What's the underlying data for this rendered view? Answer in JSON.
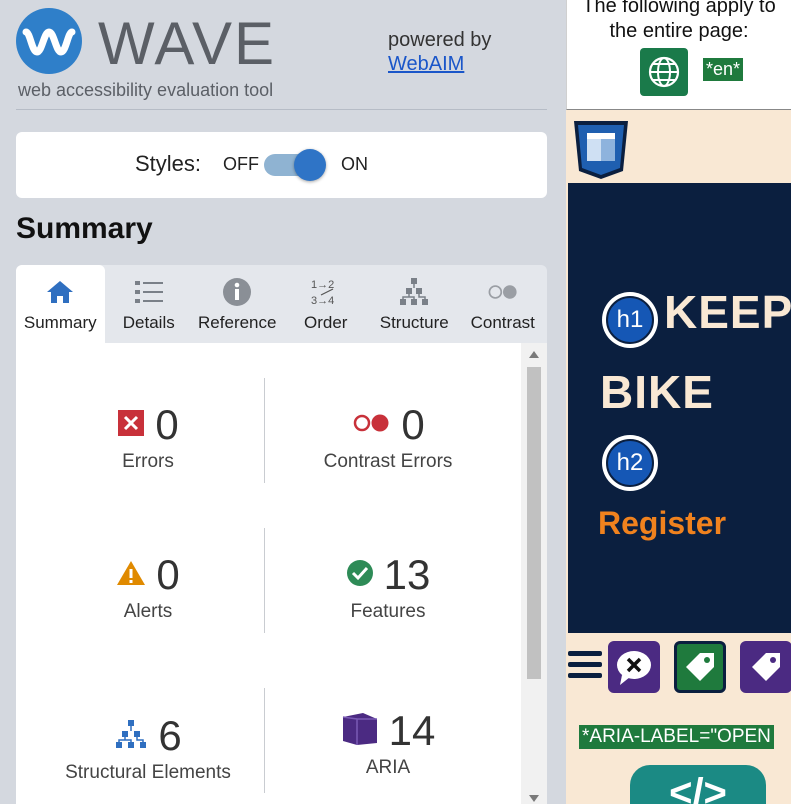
{
  "header": {
    "brand": "WAVE",
    "tagline": "web accessibility evaluation tool",
    "powered_by": "powered by",
    "powered_link": "WebAIM"
  },
  "styles_toggle": {
    "label": "Styles:",
    "off": "OFF",
    "on": "ON",
    "state": "on"
  },
  "summary_heading": "Summary",
  "tabs": [
    {
      "label": "Summary",
      "icon": "home-icon",
      "active": true
    },
    {
      "label": "Details",
      "icon": "list-icon"
    },
    {
      "label": "Reference",
      "icon": "info-icon"
    },
    {
      "label": "Order",
      "icon": "order-icon",
      "icon_text": "1→2\n3→4"
    },
    {
      "label": "Structure",
      "icon": "structure-icon"
    },
    {
      "label": "Contrast",
      "icon": "contrast-icon"
    }
  ],
  "stats": [
    {
      "label": "Errors",
      "value": "0",
      "icon": "error-icon",
      "color": "#c8313a"
    },
    {
      "label": "Contrast Errors",
      "value": "0",
      "icon": "contrast-error-icon",
      "color": "#c8313a"
    },
    {
      "label": "Alerts",
      "value": "0",
      "icon": "alert-icon",
      "color": "#e08a00"
    },
    {
      "label": "Features",
      "value": "13",
      "icon": "feature-check-icon",
      "color": "#2e8b57"
    },
    {
      "label": "Structural Elements",
      "value": "6",
      "icon": "structure-icon",
      "color": "#2f6fc0"
    },
    {
      "label": "ARIA",
      "value": "14",
      "icon": "aria-icon",
      "color": "#4b2a82"
    }
  ],
  "preview": {
    "top_text_line1": "The following apply to",
    "top_text_line2": "the entire page:",
    "lang_tag": "*en*",
    "h1_badge": "h1",
    "h1_text": "KEEP",
    "h1_text_cont": "BIKE",
    "h2_badge": "h2",
    "h2_text": "Register",
    "aria_label_tag": "*ARIA-LABEL=\"OPEN",
    "code_tag": "</>"
  }
}
